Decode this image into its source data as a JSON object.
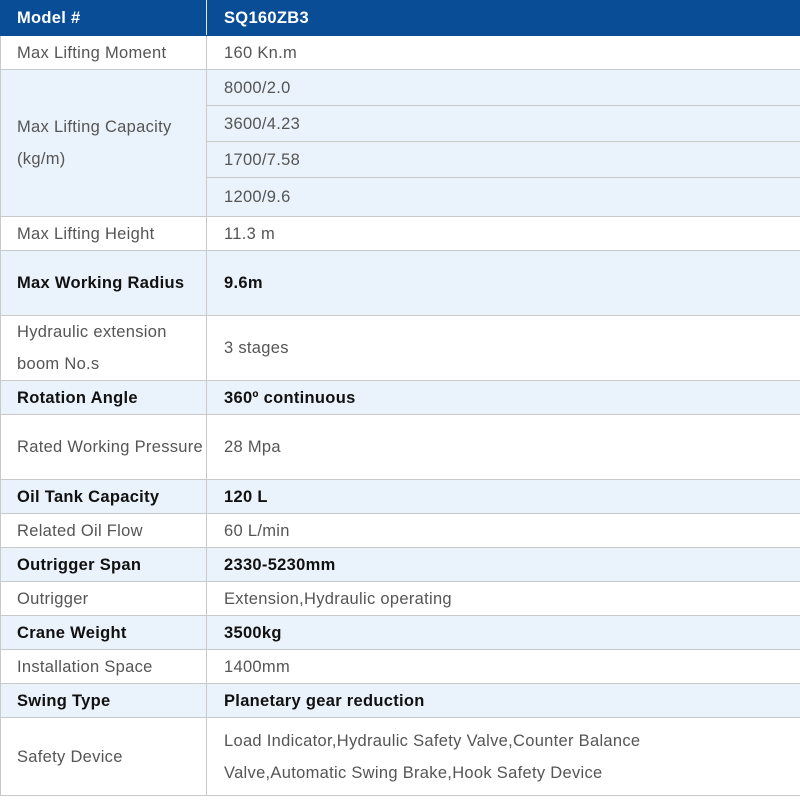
{
  "header": {
    "label": "Model #",
    "value": "SQ160ZB3"
  },
  "capacity": {
    "label": "Max Lifting Capacity (kg/m)",
    "values": [
      "8000/2.0",
      "3600/4.23",
      "1700/7.58",
      "1200/9.6"
    ]
  },
  "rows": {
    "moment": {
      "label": "Max Lifting Moment",
      "value": "160 Kn.m"
    },
    "height": {
      "label": "Max Lifting Height",
      "value": "11.3 m"
    },
    "radius": {
      "label": "Max Working Radius",
      "value": "9.6m"
    },
    "boom": {
      "label": "Hydraulic extension boom No.s",
      "value": "3 stages"
    },
    "rotation": {
      "label": "Rotation Angle",
      "value": "360º continuous"
    },
    "pressure": {
      "label": "Rated Working Pressure",
      "value": "28 Mpa"
    },
    "tank": {
      "label": "Oil Tank Capacity",
      "value": "120  L"
    },
    "flow": {
      "label": "Related Oil Flow",
      "value": "60  L/min"
    },
    "span": {
      "label": "Outrigger Span",
      "value": "2330-5230mm"
    },
    "outrigger": {
      "label": "Outrigger",
      "value": "Extension,Hydraulic operating"
    },
    "weight": {
      "label": "Crane Weight",
      "value": "3500kg"
    },
    "space": {
      "label": "Installation Space",
      "value": "1400mm"
    },
    "swing": {
      "label": "Swing Type",
      "value": "Planetary gear reduction"
    },
    "safety": {
      "label": "Safety Device",
      "value": "Load Indicator,Hydraulic Safety Valve,Counter Balance Valve,Automatic Swing Brake,Hook Safety Device"
    }
  },
  "colors": {
    "header_bg": "#0a4d97",
    "highlight_bg": "#eaf3fb",
    "border": "#c9c9c9",
    "text_gray": "#555555"
  }
}
